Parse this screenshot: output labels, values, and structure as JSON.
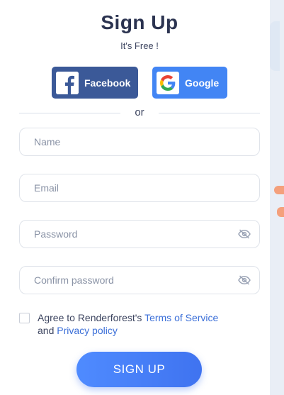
{
  "header": {
    "title": "Sign Up",
    "subtitle": "It's Free !"
  },
  "social": {
    "facebook_label": "Facebook",
    "google_label": "Google",
    "facebook_icon": "facebook-icon",
    "google_icon": "google-icon",
    "facebook_color": "#3b5998",
    "google_color": "#4285f4"
  },
  "divider": {
    "text": "or"
  },
  "form": {
    "name_placeholder": "Name",
    "email_placeholder": "Email",
    "password_placeholder": "Password",
    "confirm_placeholder": "Confirm password",
    "name_value": "",
    "email_value": "",
    "password_value": "",
    "confirm_value": "",
    "password_icon": "eye-off-icon"
  },
  "agreement": {
    "checked": false,
    "prefix": "Agree to Renderforest's",
    "terms_link": "Terms of Service",
    "and": "and",
    "privacy_link": "Privacy policy"
  },
  "submit": {
    "label": "SIGN UP",
    "color": "#4f8bff"
  }
}
